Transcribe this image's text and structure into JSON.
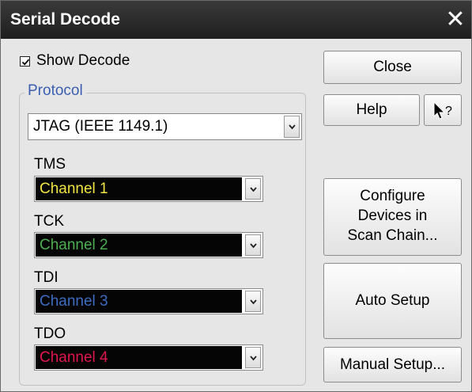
{
  "window": {
    "title": "Serial Decode"
  },
  "show_decode": {
    "label": "Show Decode",
    "checked": true
  },
  "protocol": {
    "label": "Protocol",
    "selected": "JTAG (IEEE 1149.1)"
  },
  "signals": [
    {
      "label": "TMS",
      "value": "Channel 1",
      "color": "#f0e442"
    },
    {
      "label": "TCK",
      "value": "Channel 2",
      "color": "#4caf50"
    },
    {
      "label": "TDI",
      "value": "Channel 3",
      "color": "#3d6cc2"
    },
    {
      "label": "TDO",
      "value": "Channel 4",
      "color": "#e0164e"
    }
  ],
  "buttons": {
    "close": "Close",
    "help": "Help",
    "whats_this": "↖?",
    "configure_line1": "Configure",
    "configure_line2": "Devices in",
    "configure_line3": "Scan Chain...",
    "auto_setup": "Auto Setup",
    "manual_setup": "Manual Setup..."
  }
}
